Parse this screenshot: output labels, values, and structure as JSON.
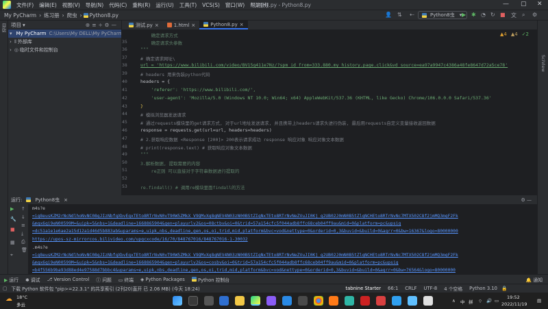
{
  "menubar": {
    "items": [
      "文件(F)",
      "编辑(E)",
      "视图(V)",
      "导航(N)",
      "代码(C)",
      "重构(R)",
      "运行(U)",
      "工具(T)",
      "VCS(S)",
      "窗口(W)",
      "帮助(H)"
    ],
    "window_title": "小视频.py - Python8.py"
  },
  "navbar": {
    "crumbs": [
      "My PyCharm",
      "练习册",
      "爬虫",
      "Python8.py"
    ],
    "run_config": "Python8虫"
  },
  "leftstrip": {
    "label": "项目"
  },
  "project": {
    "header": "项目",
    "root": "My PyCharm",
    "root_path": "C:\\Users\\My DELL\\My PyCharm",
    "ext_libs": "外部库",
    "scratches": "临时文件和控制台"
  },
  "tabs": [
    {
      "label": "测试.py",
      "icon": "python-file-icon"
    },
    {
      "label": "1.html",
      "icon": "html-file-icon"
    },
    {
      "label": "Python8.py",
      "icon": "python-file-icon",
      "active": true
    }
  ],
  "inspections": {
    "warnings": "▲4",
    "weak": "▲4",
    "typos": "✓2"
  },
  "code_lines": [
    {
      "n": "",
      "text": "    确定请求方式",
      "cls": "doc"
    },
    {
      "n": "35",
      "text": "    确定请求头参数",
      "cls": "doc"
    },
    {
      "n": "36",
      "text": "\"\"\"",
      "cls": "doc"
    },
    {
      "n": "37",
      "text": "# 确定请求网址\\",
      "cls": "cm"
    },
    {
      "n": "38",
      "text": "url = 'https://www.bilibili.com/video/BV15g411e7Nz/?spm_id_from=333.880.my_history.page.click&vd_source=ea97a9947c4386a48fe8647d72a5ce78'",
      "cls": "url"
    },
    {
      "n": "39",
      "text": "# headers 用来伪装python代码",
      "cls": "cm"
    },
    {
      "n": "40",
      "text": "headers = {",
      "cls": ""
    },
    {
      "n": "41",
      "text": "    'referer': 'https://www.bilibili.com/',",
      "cls": "st"
    },
    {
      "n": "42",
      "text": "    'user-agent': 'Mozilla/5.0 (Windows NT 10.0; Win64; x64) AppleWebKit/537.36 (KHTML, like Gecko) Chrome/106.0.0.0 Safari/537.36'",
      "cls": "st"
    },
    {
      "n": "43",
      "text": "}",
      "cls": ""
    },
    {
      "n": "44",
      "text": "# 模拟浏览器发送请求",
      "cls": "cm"
    },
    {
      "n": "45",
      "text": "# 通过requests模块里的get请求方式, 对于url地址发送请求, 并且携带上headers请求头进行伪装, 最后用requests自定义变量接收返回数据",
      "cls": "cm"
    },
    {
      "n": "46",
      "text": "response = requests.get(url=url, headers=headers)",
      "cls": ""
    },
    {
      "n": "47",
      "text": "# 2.获取响应数据 <Response [200]> 200表示请求成功 response 响应对象 响应对象文本数据",
      "cls": "cm"
    },
    {
      "n": "48",
      "text": "# print(response.text) # 获取响应对象文本数据",
      "cls": "cm"
    },
    {
      "n": "49",
      "text": "\"\"\"",
      "cls": "doc"
    },
    {
      "n": "50",
      "text": "3.解析数据, 提取需要的内容",
      "cls": "doc"
    },
    {
      "n": "51",
      "text": "    re正则 可以直接对于字符串数据进行提取的",
      "cls": "doc"
    },
    {
      "n": "52",
      "text": "",
      "cls": ""
    },
    {
      "n": "53",
      "text": "re.findall() # 调用re模块里面findall的方法",
      "cls": "doc"
    }
  ],
  "run": {
    "label": "运行:",
    "config": "Python8虫",
    "output": [
      "m4s?e",
      "=ig8eusKZM2rNcNdlhoNvNC08qJIzNbfqXbvEqxTEto8RTrNvN0vT90W5ZMkX_V9QMvXq8qNEV4N03zN00BStZIqNxTEto8RTrNvNeZVuJI0Kj_q2UB02J0mN0B5tZlqNCHEto8RTrNvNc7MTX502C8f2jmMQ3mqF2Fk",
      "&mqx6qi9eN00599M=&uipk=5&nbs=1&deadline=1668865904&gen=playurlv2&os=08ctbv&oi=0&trid=57a154cfc5f044adb8ffc68ceb04ff9au&mid=0&platform=pc&upsig",
      "=dc51a1e1e6ae2a15d12a1d46d5b883ab&uparams=e,uipk,nbs,deadline,gen,os,oi,trid,mid,platform&bvc=vod&nettype=0&orderid=0,3&buvid=&build=0&agrr=0&bw=16367&logo=80000000",
      "https://upos-sz-mirrorcos.bilivideo.com/upgcxcode/16/70/848767016/848767016-1-30032",
      ".m4s?e",
      "=ig8eusKZM2rNcNdlhoNvNC08qJIzNbfqXbvEqxTEto8RTrNvN0vT90W5ZMkX_V9QMvXq8qNEV4N03zN00BStZIqNxTEto8RTrNvNeZVuJI0Kj_q2UB02J0mN0B5tZlqNCHEto8RTrNvNc7MTX502C8f2jmMQ3mqF2Fk",
      "&mqx6qi9eN00599M=&uipk=5&nbs=1&deadline=1668865904&gen=playurlv2&os=cosbv&oi=0&trid=57a154cfc5f044adb8ffc68ceb04ff9au&mid=0&platform=pc&upsig",
      "=b4f556b9ba93d88ed4e97588d7bbbc4&uparams=e,uipk,nbs,deadline,gen,os,oi,trid,mid,platform&bvc=vod&nettype=0&orderid=0,3&buvid=&build=0&agrr=0&bw=76564&logo=80000000"
    ]
  },
  "toolwin": [
    "运行",
    "调试",
    "Version Control",
    "问题",
    "终端",
    "Python Packages",
    "Python 控制台"
  ],
  "toolwin_right": "通知",
  "statusbar": {
    "message": "下载 Python 软件包 \"pip>=22.3.1\" 的共享索引 (2刊20)直开 已 2.06 MB) (今天 18:24)",
    "tabnine": "tabnine Starter",
    "pos": "66:1",
    "eol": "CRLF",
    "enc": "UTF-8",
    "indent": "4 个空格",
    "interp": "Python 3.10"
  },
  "taskbar": {
    "weather_temp": "18°C",
    "weather_desc": "多云",
    "time": "19:52",
    "date": "2022/11/19",
    "ime": "拼",
    "lang": "中"
  }
}
